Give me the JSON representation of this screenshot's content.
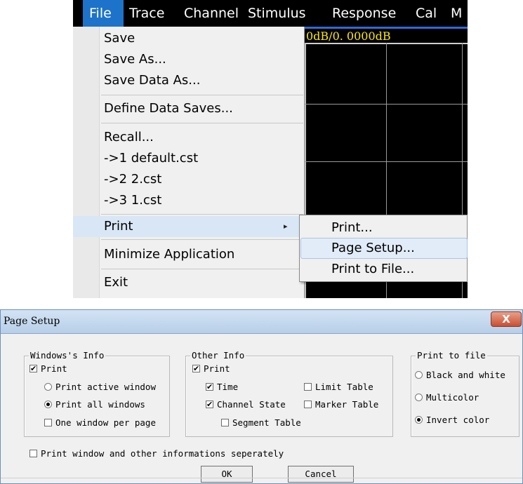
{
  "menubar": {
    "items": [
      "File",
      "Trace",
      "Channel",
      "Stimulus",
      "Response",
      "Cal",
      "M"
    ]
  },
  "trace": {
    "scale_label": "0dB/0. 0000dB"
  },
  "file_menu": {
    "items": [
      "Save",
      "Save As...",
      "Save Data As...",
      "Define Data Saves...",
      "Recall...",
      "->1 default.cst",
      "->2 2.cst",
      "->3 1.cst",
      "Print",
      "Minimize Application",
      "Exit"
    ],
    "submenu_arrow": "▸"
  },
  "print_submenu": {
    "items": [
      "Print...",
      "Page Setup...",
      "Print to File..."
    ]
  },
  "dialog": {
    "title": "Page Setup",
    "close_symbol": "X",
    "windows_info": {
      "legend": "Windows's Info",
      "print": {
        "label": "Print",
        "checked": true
      },
      "active_window": {
        "label": "Print active window",
        "selected": false
      },
      "all_windows": {
        "label": "Print all windows",
        "selected": true
      },
      "one_per_page": {
        "label": "One window per page",
        "checked": false
      }
    },
    "other_info": {
      "legend": "Other Info",
      "print": {
        "label": "Print",
        "checked": true
      },
      "time": {
        "label": "Time",
        "checked": true
      },
      "channel_state": {
        "label": "Channel State",
        "checked": true
      },
      "segment_table": {
        "label": "Segment Table",
        "checked": false
      },
      "limit_table": {
        "label": "Limit Table",
        "checked": false
      },
      "marker_table": {
        "label": "Marker Table",
        "checked": false
      }
    },
    "print_to_file": {
      "legend": "Print to file",
      "black_white": {
        "label": "Black and white",
        "selected": false
      },
      "multicolor": {
        "label": "Multicolor",
        "selected": false
      },
      "invert": {
        "label": "Invert color",
        "selected": true
      }
    },
    "separately": {
      "label": "Print window and other informations seperately",
      "checked": false
    },
    "ok_label": "OK",
    "cancel_label": "Cancel"
  },
  "colors": {
    "menu_highlight": "#1d73c9",
    "trace_label": "#ffe800",
    "grid": "#9a9a9a"
  }
}
